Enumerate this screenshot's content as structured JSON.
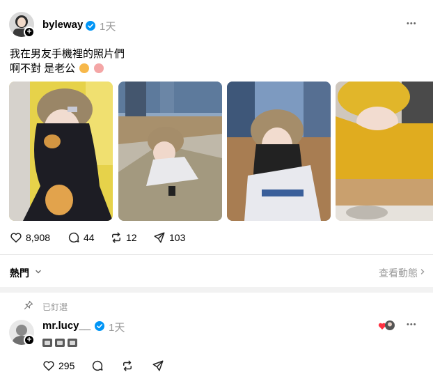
{
  "post": {
    "username": "byleway",
    "time": "1天",
    "more": "•••",
    "caption_line1": "我在男友手機裡的照片們",
    "caption_line2": "啊不對 是老公",
    "stats": {
      "likes": "8,908",
      "comments": "44",
      "reposts": "12",
      "shares": "103"
    }
  },
  "sort": {
    "label": "熱門",
    "view_activity": "查看動態"
  },
  "pinned": {
    "label": "已釘選"
  },
  "reply": {
    "username": "mr.lucy__",
    "time": "1天",
    "more": "•••",
    "likes": "295"
  },
  "colors": {
    "verified": "#0095f6",
    "muted": "#999999",
    "divider": "#e5e5e5"
  }
}
